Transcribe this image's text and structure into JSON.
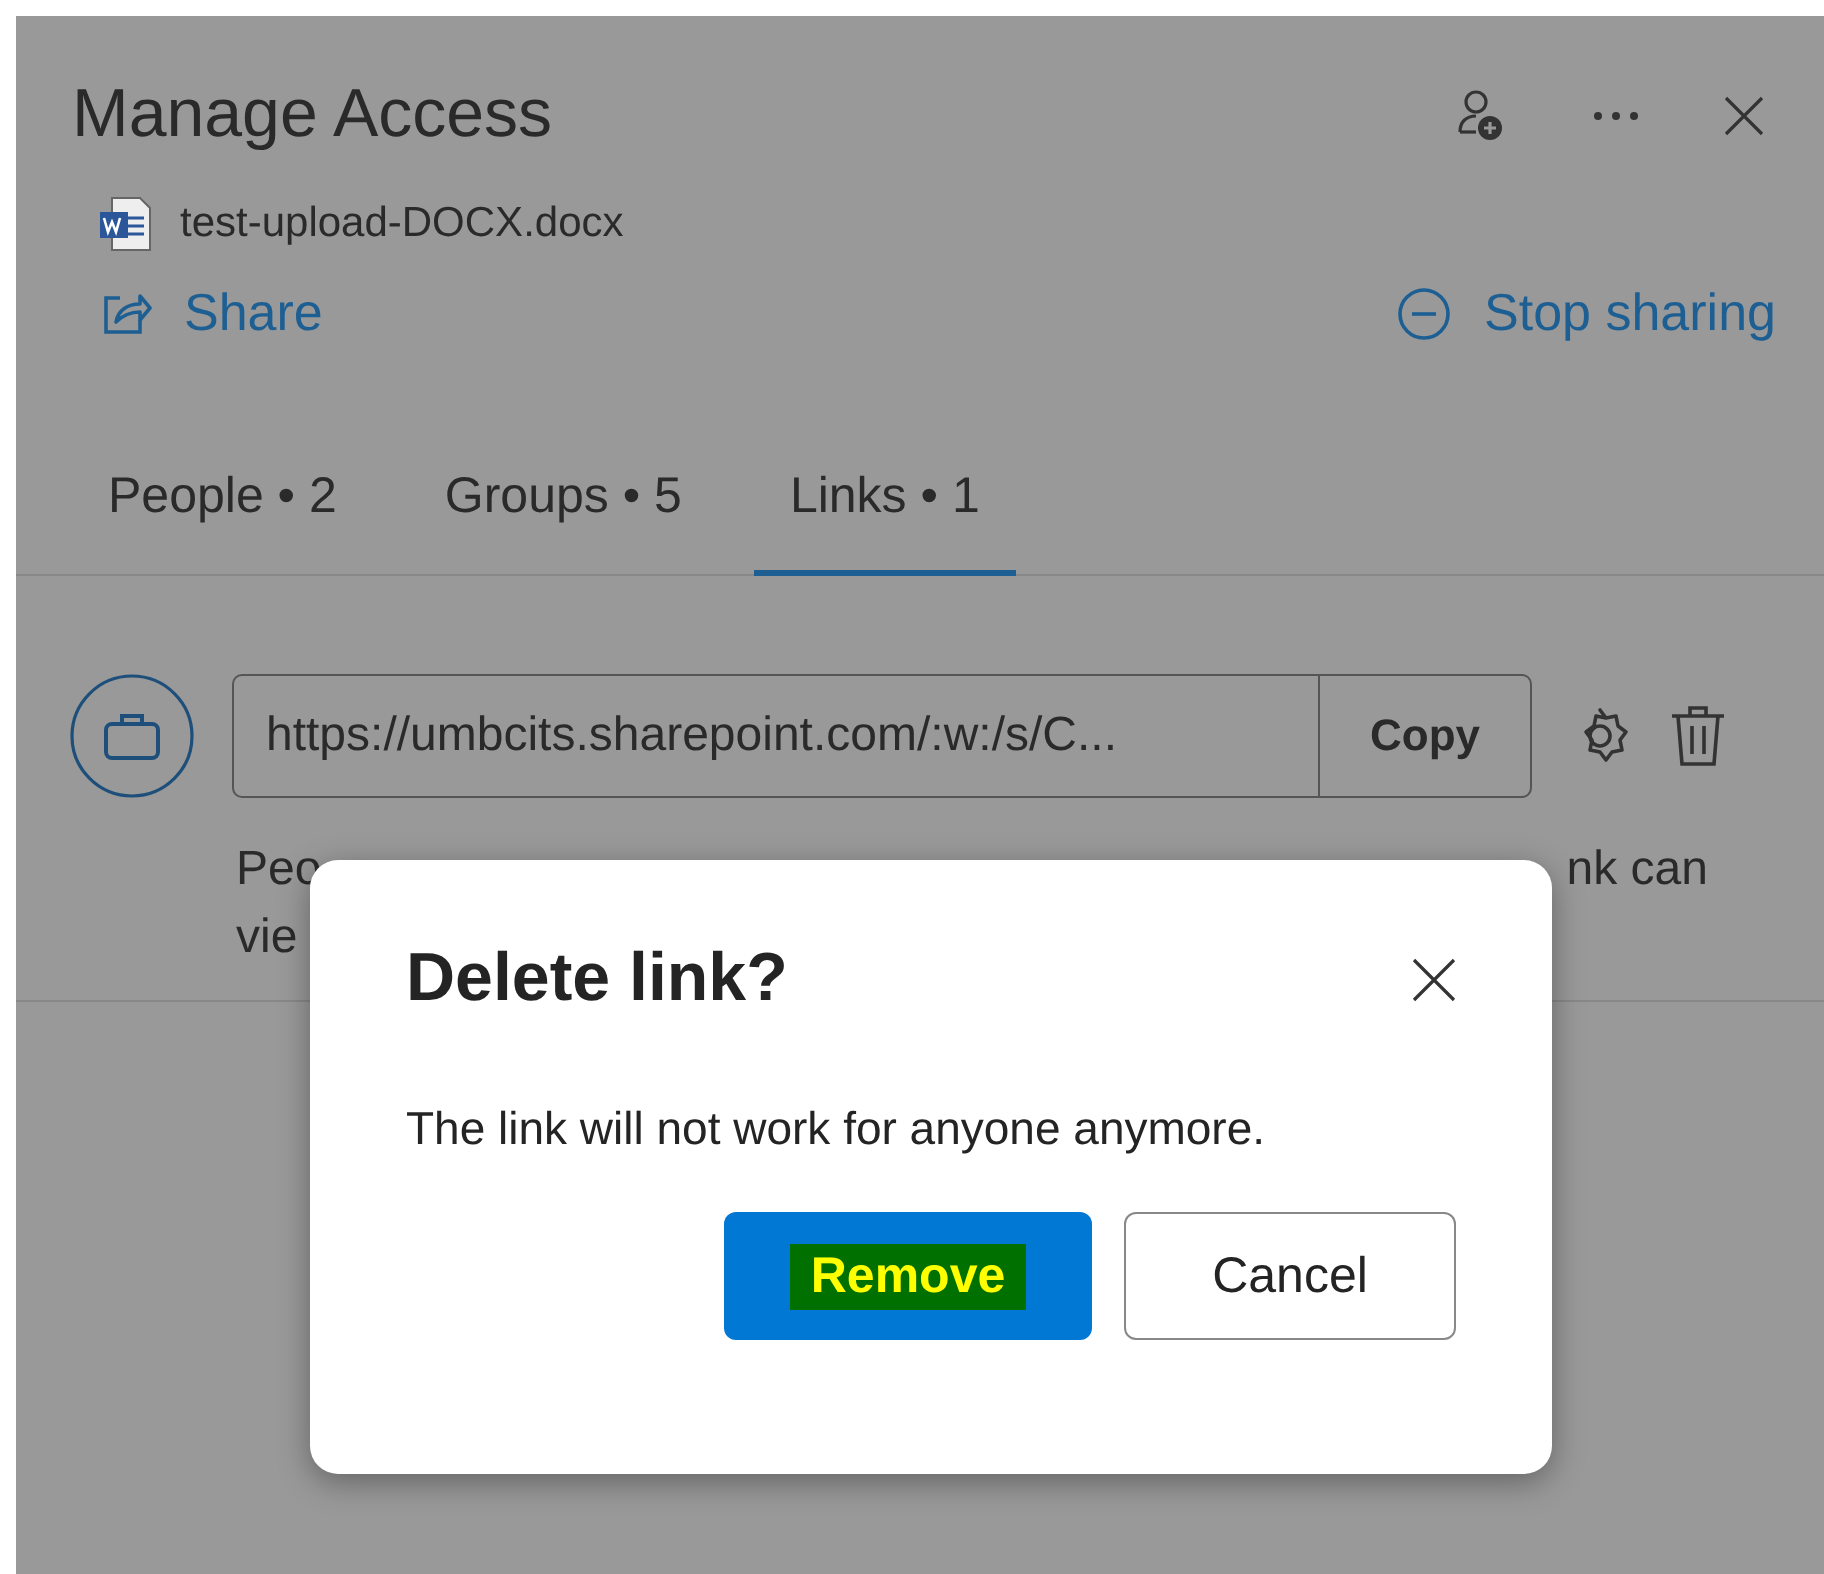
{
  "panel": {
    "title": "Manage Access",
    "file_name": "test-upload-DOCX.docx",
    "share_label": "Share",
    "stop_sharing_label": "Stop sharing"
  },
  "tabs": [
    {
      "label": "People • 2",
      "selected": false
    },
    {
      "label": "Groups • 5",
      "selected": false
    },
    {
      "label": "Links • 1",
      "selected": true
    }
  ],
  "link": {
    "url": "https://umbcits.sharepoint.com/:w:/s/C...",
    "copy_label": "Copy",
    "description_left_lines": [
      "Peo",
      "vie"
    ],
    "description_right": "nk can"
  },
  "dialog": {
    "title": "Delete link?",
    "message": "The link will not work for anyone anymore.",
    "remove_label": "Remove",
    "cancel_label": "Cancel"
  }
}
